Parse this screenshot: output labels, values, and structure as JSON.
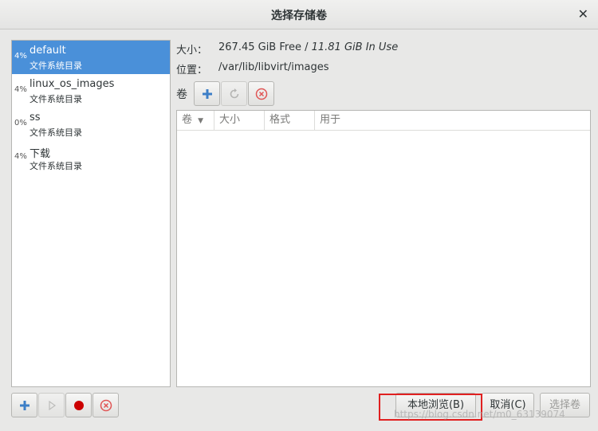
{
  "window": {
    "title": "选择存储卷"
  },
  "pools": [
    {
      "pct": "4%",
      "name": "default",
      "type": "文件系统目录",
      "selected": true
    },
    {
      "pct": "4%",
      "name": "linux_os_images",
      "type": "文件系统目录"
    },
    {
      "pct": "0%",
      "name": "ss",
      "type": "文件系统目录"
    },
    {
      "pct": "4%",
      "name": "下载",
      "type": "文件系统目录"
    }
  ],
  "info": {
    "size_label": "大小：",
    "size_free": "267.45 GiB Free",
    "size_sep": " / ",
    "size_used": "11.81 GiB In Use",
    "location_label": "位置：",
    "location_value": "/var/lib/libvirt/images"
  },
  "volumes": {
    "label": "卷",
    "columns": [
      "卷",
      "大小",
      "格式",
      "用于"
    ]
  },
  "buttons": {
    "browse_local": "本地浏览(B)",
    "cancel": "取消(C)",
    "choose_volume": "选择卷"
  },
  "watermark": "https://blog.csdn.net/m0_63139074",
  "colors": {
    "selection": "#4a90d9",
    "add_icon": "#3d7fc7",
    "stop_icon": "#cc0000",
    "delete_icon": "#e05555",
    "highlight_box": "#e02020"
  }
}
